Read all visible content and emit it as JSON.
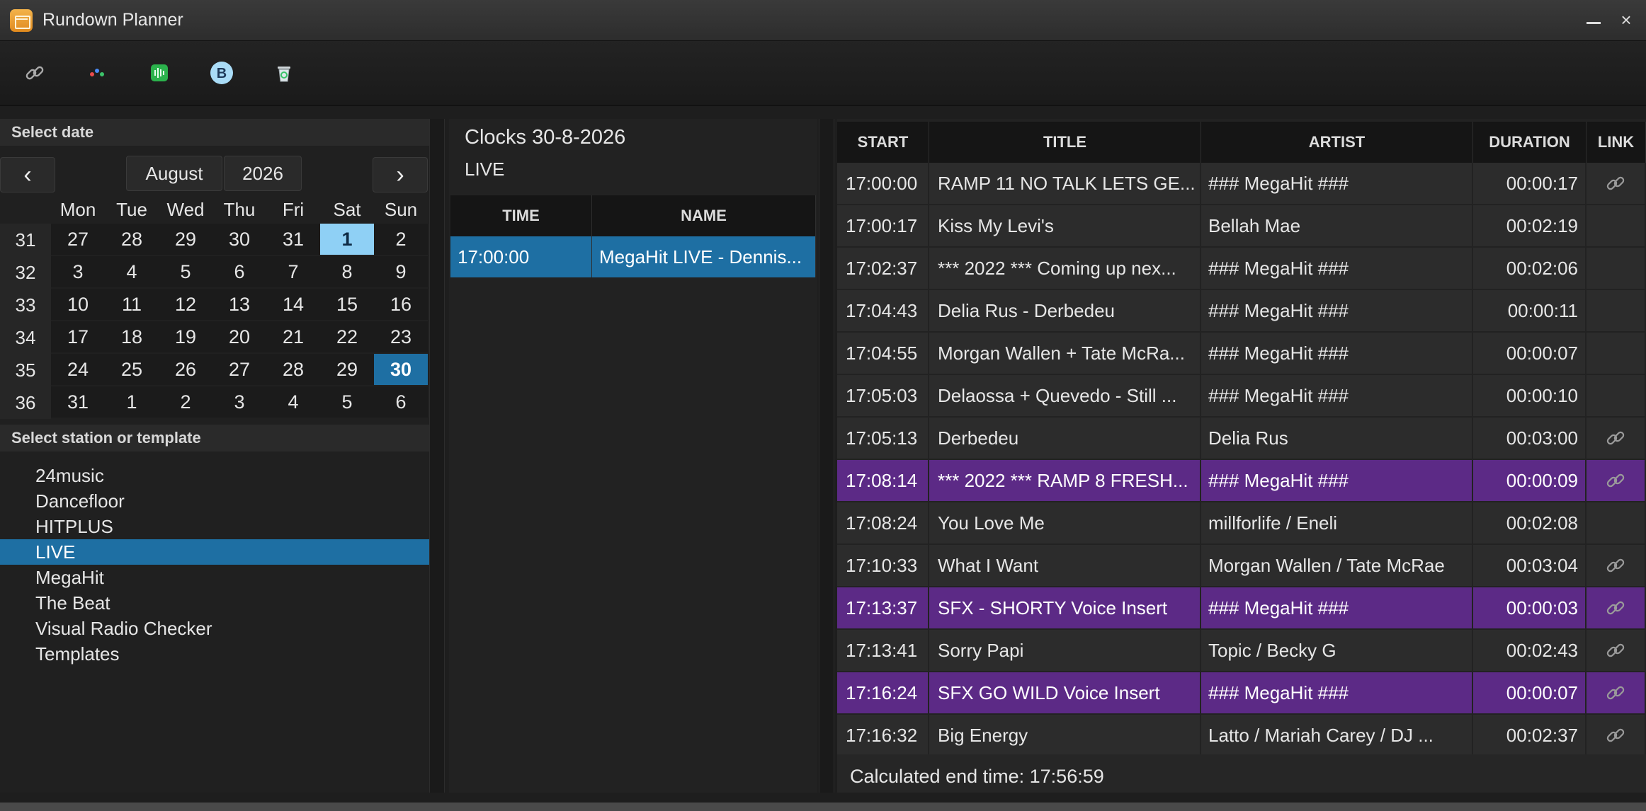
{
  "window": {
    "title": "Rundown Planner"
  },
  "toolbar": {
    "buttons": [
      {
        "icon": "link-icon"
      },
      {
        "icon": "dots-icon"
      },
      {
        "icon": "audio-wave-icon"
      },
      {
        "icon": "b-badge-icon",
        "label": "B"
      },
      {
        "icon": "recycle-bin-icon"
      }
    ]
  },
  "calendar": {
    "header": "Select date",
    "prev": "‹",
    "next": "›",
    "month": "August",
    "year": "2026",
    "weekdays": [
      "Mon",
      "Tue",
      "Wed",
      "Thu",
      "Fri",
      "Sat",
      "Sun"
    ],
    "weeks": [
      {
        "week": "31",
        "days": [
          "27",
          "28",
          "29",
          "30",
          "31",
          "1",
          "2"
        ]
      },
      {
        "week": "32",
        "days": [
          "3",
          "4",
          "5",
          "6",
          "7",
          "8",
          "9"
        ]
      },
      {
        "week": "33",
        "days": [
          "10",
          "11",
          "12",
          "13",
          "14",
          "15",
          "16"
        ]
      },
      {
        "week": "34",
        "days": [
          "17",
          "18",
          "19",
          "20",
          "21",
          "22",
          "23"
        ]
      },
      {
        "week": "35",
        "days": [
          "24",
          "25",
          "26",
          "27",
          "28",
          "29",
          "30"
        ]
      },
      {
        "week": "36",
        "days": [
          "31",
          "1",
          "2",
          "3",
          "4",
          "5",
          "6"
        ]
      }
    ],
    "highlight_light": {
      "week_index": 0,
      "day_index": 5
    },
    "highlight_selected": {
      "week_index": 4,
      "day_index": 6
    }
  },
  "stations": {
    "header": "Select station or template",
    "items": [
      "24music",
      "Dancefloor",
      "HITPLUS",
      "LIVE",
      "MegaHit",
      "The Beat",
      "Visual Radio Checker",
      "Templates"
    ],
    "active": "LIVE"
  },
  "clocks": {
    "title": "Clocks 30-8-2026",
    "subtitle": "LIVE",
    "columns": [
      "TIME",
      "NAME"
    ],
    "rows": [
      {
        "time": "17:00:00",
        "name": "MegaHit LIVE - Dennis..."
      }
    ]
  },
  "rundown": {
    "columns": [
      "START",
      "TITLE",
      "ARTIST",
      "DURATION",
      "LINK"
    ],
    "rows": [
      {
        "start": "17:00:00",
        "title": "RAMP 11 NO TALK LETS GE...",
        "artist": "### MegaHit ###",
        "duration": "00:00:17",
        "link": true,
        "purple": false
      },
      {
        "start": "17:00:17",
        "title": "Kiss My Levi's",
        "artist": "Bellah Mae",
        "duration": "00:02:19",
        "link": false,
        "purple": false
      },
      {
        "start": "17:02:37",
        "title": "*** 2022 *** Coming up nex...",
        "artist": "### MegaHit ###",
        "duration": "00:02:06",
        "link": false,
        "purple": false
      },
      {
        "start": "17:04:43",
        "title": "Delia Rus - Derbedeu",
        "artist": "### MegaHit ###",
        "duration": "00:00:11",
        "link": false,
        "purple": false
      },
      {
        "start": "17:04:55",
        "title": "Morgan Wallen + Tate McRa...",
        "artist": "### MegaHit ###",
        "duration": "00:00:07",
        "link": false,
        "purple": false
      },
      {
        "start": "17:05:03",
        "title": "Delaossa + Quevedo - Still ...",
        "artist": "### MegaHit ###",
        "duration": "00:00:10",
        "link": false,
        "purple": false
      },
      {
        "start": "17:05:13",
        "title": "Derbedeu",
        "artist": "Delia Rus",
        "duration": "00:03:00",
        "link": true,
        "purple": false
      },
      {
        "start": "17:08:14",
        "title": "*** 2022 *** RAMP 8 FRESH...",
        "artist": "### MegaHit ###",
        "duration": "00:00:09",
        "link": true,
        "purple": true
      },
      {
        "start": "17:08:24",
        "title": "You Love Me",
        "artist": "millforlife / Eneli",
        "duration": "00:02:08",
        "link": false,
        "purple": false
      },
      {
        "start": "17:10:33",
        "title": "What I Want",
        "artist": "Morgan Wallen / Tate McRae",
        "duration": "00:03:04",
        "link": true,
        "purple": false
      },
      {
        "start": "17:13:37",
        "title": "SFX - SHORTY  Voice Insert",
        "artist": "### MegaHit ###",
        "duration": "00:00:03",
        "link": true,
        "purple": true
      },
      {
        "start": "17:13:41",
        "title": "Sorry Papi",
        "artist": "Topic / Becky G",
        "duration": "00:02:43",
        "link": true,
        "purple": false
      },
      {
        "start": "17:16:24",
        "title": "SFX GO WILD  Voice Insert",
        "artist": "### MegaHit ###",
        "duration": "00:00:07",
        "link": true,
        "purple": true
      },
      {
        "start": "17:16:32",
        "title": "Big Energy",
        "artist": "Latto / Mariah Carey / DJ ...",
        "duration": "00:02:37",
        "link": true,
        "purple": false
      }
    ],
    "footer": "Calculated end time: 17:56:59"
  },
  "colors": {
    "selection_blue": "#1e6fa3",
    "highlight_light_blue": "#8fd0f5",
    "purple_row": "#5c2a86"
  }
}
